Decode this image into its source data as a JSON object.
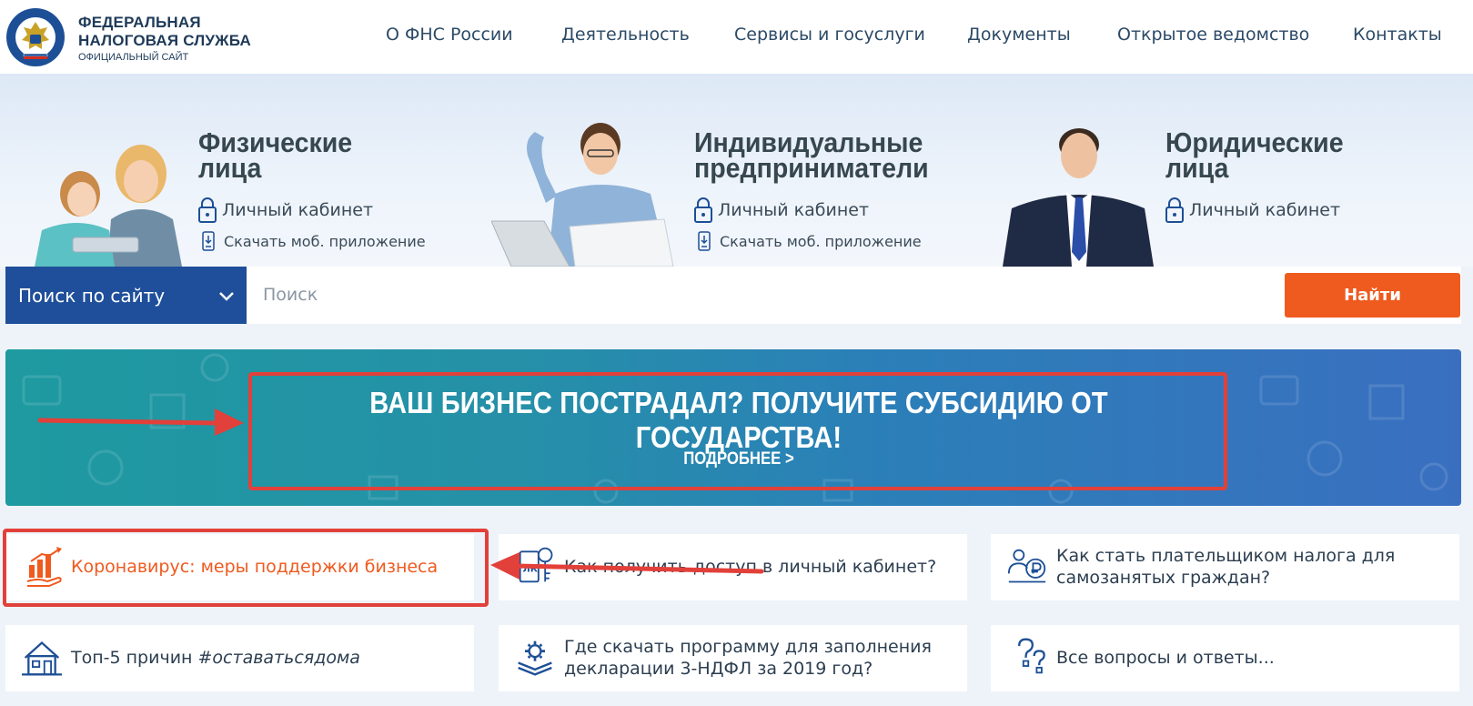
{
  "header": {
    "brand_line1": "ФЕДЕРАЛЬНАЯ",
    "brand_line2": "НАЛОГОВАЯ СЛУЖБА",
    "brand_sub": "ОФИЦИАЛЬНЫЙ САЙТ",
    "logo_ring_text": "ФЕДЕРАЛЬНАЯ НАЛОГОВАЯ СЛУЖБА",
    "nav": [
      "О ФНС России",
      "Деятельность",
      "Сервисы и госуслуги",
      "Документы",
      "Открытое ведомство",
      "Контакты"
    ]
  },
  "segments": [
    {
      "title1": "Физические",
      "title2": "лица",
      "cabinet": "Личный кабинет",
      "app": "Скачать моб. приложение"
    },
    {
      "title1": "Индивидуальные",
      "title2": "предприниматели",
      "cabinet": "Личный кабинет",
      "app": "Скачать моб. приложение"
    },
    {
      "title1": "Юридические",
      "title2": "лица",
      "cabinet": "Личный кабинет"
    }
  ],
  "search": {
    "scope_label": "Поиск по сайту",
    "placeholder": "Поиск",
    "button_label": "Найти"
  },
  "banner": {
    "title": "ВАШ БИЗНЕС ПОСТРАДАЛ? ПОЛУЧИТЕ СУБСИДИЮ ОТ ГОСУДАРСТВА!",
    "more": "ПОДРОБНЕЕ >"
  },
  "cards": [
    {
      "line1": "Коронавирус: меры поддержки бизнеса",
      "icon": "growth-chart-hand-icon"
    },
    {
      "line1": "Как получить доступ в личный кабинет?",
      "icon": "lk-key-icon"
    },
    {
      "line1": "Как стать плательщиком налога для",
      "line2": "самозанятых граждан?",
      "icon": "self-employed-ruble-icon"
    },
    {
      "line1_plain": "Топ-5 причин ",
      "line1_italic": "#оставатьсядома",
      "icon": "house-icon"
    },
    {
      "line1": "Где скачать программу для заполнения",
      "line2": "декларации 3-НДФЛ за 2019 год?",
      "icon": "gear-layers-icon"
    },
    {
      "line1": "Все вопросы и ответы...",
      "icon": "question-marks-icon"
    }
  ],
  "colors": {
    "accent_orange": "#ef5a1f",
    "search_scope_blue": "#1f4f9a",
    "annotation_red": "#e2403a",
    "text_dark": "#2c3e50"
  }
}
